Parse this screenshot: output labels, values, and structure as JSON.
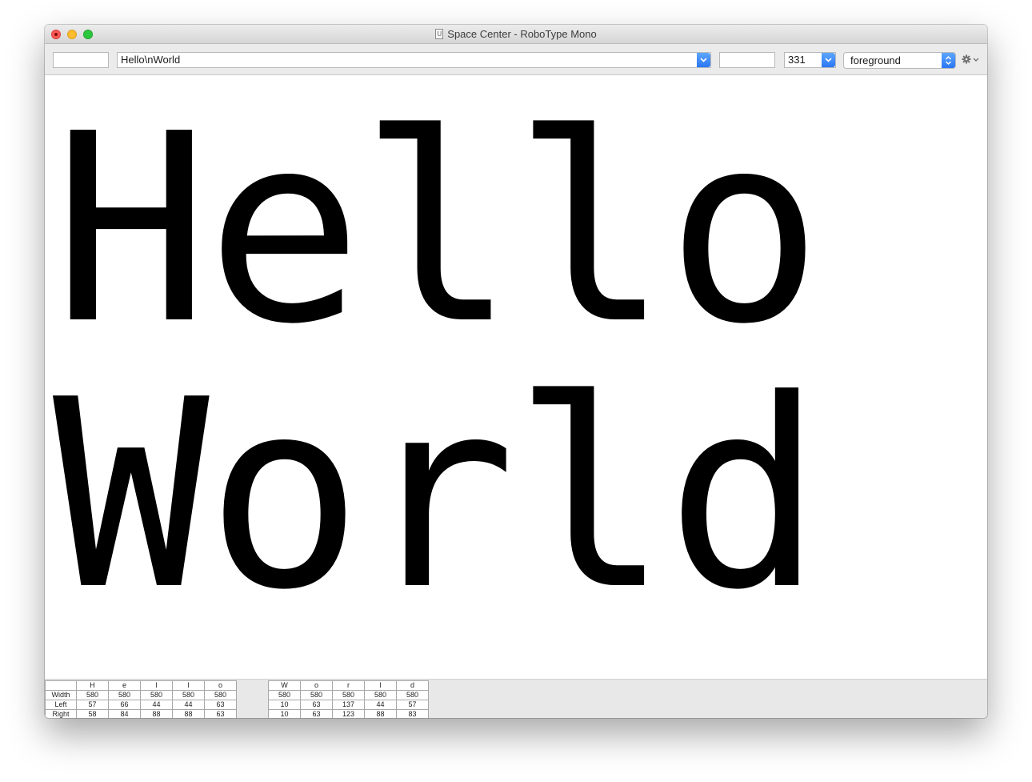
{
  "window": {
    "title": "Space Center - RoboType Mono",
    "doc_icon": "U"
  },
  "toolbar": {
    "glyph_input_value": "",
    "text_combo_value": "Hello\\nWorld",
    "pre_post_input_value": "",
    "size_value": "331",
    "layer_value": "foreground",
    "gear_icon": "gear-icon"
  },
  "preview": {
    "lines": [
      "Hello",
      "World"
    ]
  },
  "metrics": {
    "row_labels": [
      "Width",
      "Left",
      "Right"
    ],
    "groups": [
      {
        "glyphs": [
          {
            "name": "H",
            "width": "580",
            "left": "57",
            "right": "58"
          },
          {
            "name": "e",
            "width": "580",
            "left": "66",
            "right": "84"
          },
          {
            "name": "l",
            "width": "580",
            "left": "44",
            "right": "88"
          },
          {
            "name": "l",
            "width": "580",
            "left": "44",
            "right": "88"
          },
          {
            "name": "o",
            "width": "580",
            "left": "63",
            "right": "63"
          }
        ]
      },
      {
        "glyphs": [
          {
            "name": "W",
            "width": "580",
            "left": "10",
            "right": "10"
          },
          {
            "name": "o",
            "width": "580",
            "left": "63",
            "right": "63"
          },
          {
            "name": "r",
            "width": "580",
            "left": "137",
            "right": "123"
          },
          {
            "name": "l",
            "width": "580",
            "left": "44",
            "right": "88"
          },
          {
            "name": "d",
            "width": "580",
            "left": "57",
            "right": "83"
          }
        ]
      }
    ]
  },
  "colors": {
    "accent": "#2b76f3",
    "close": "#fc5b57",
    "minimize": "#fdbb2e",
    "maximize": "#2ac73f"
  }
}
